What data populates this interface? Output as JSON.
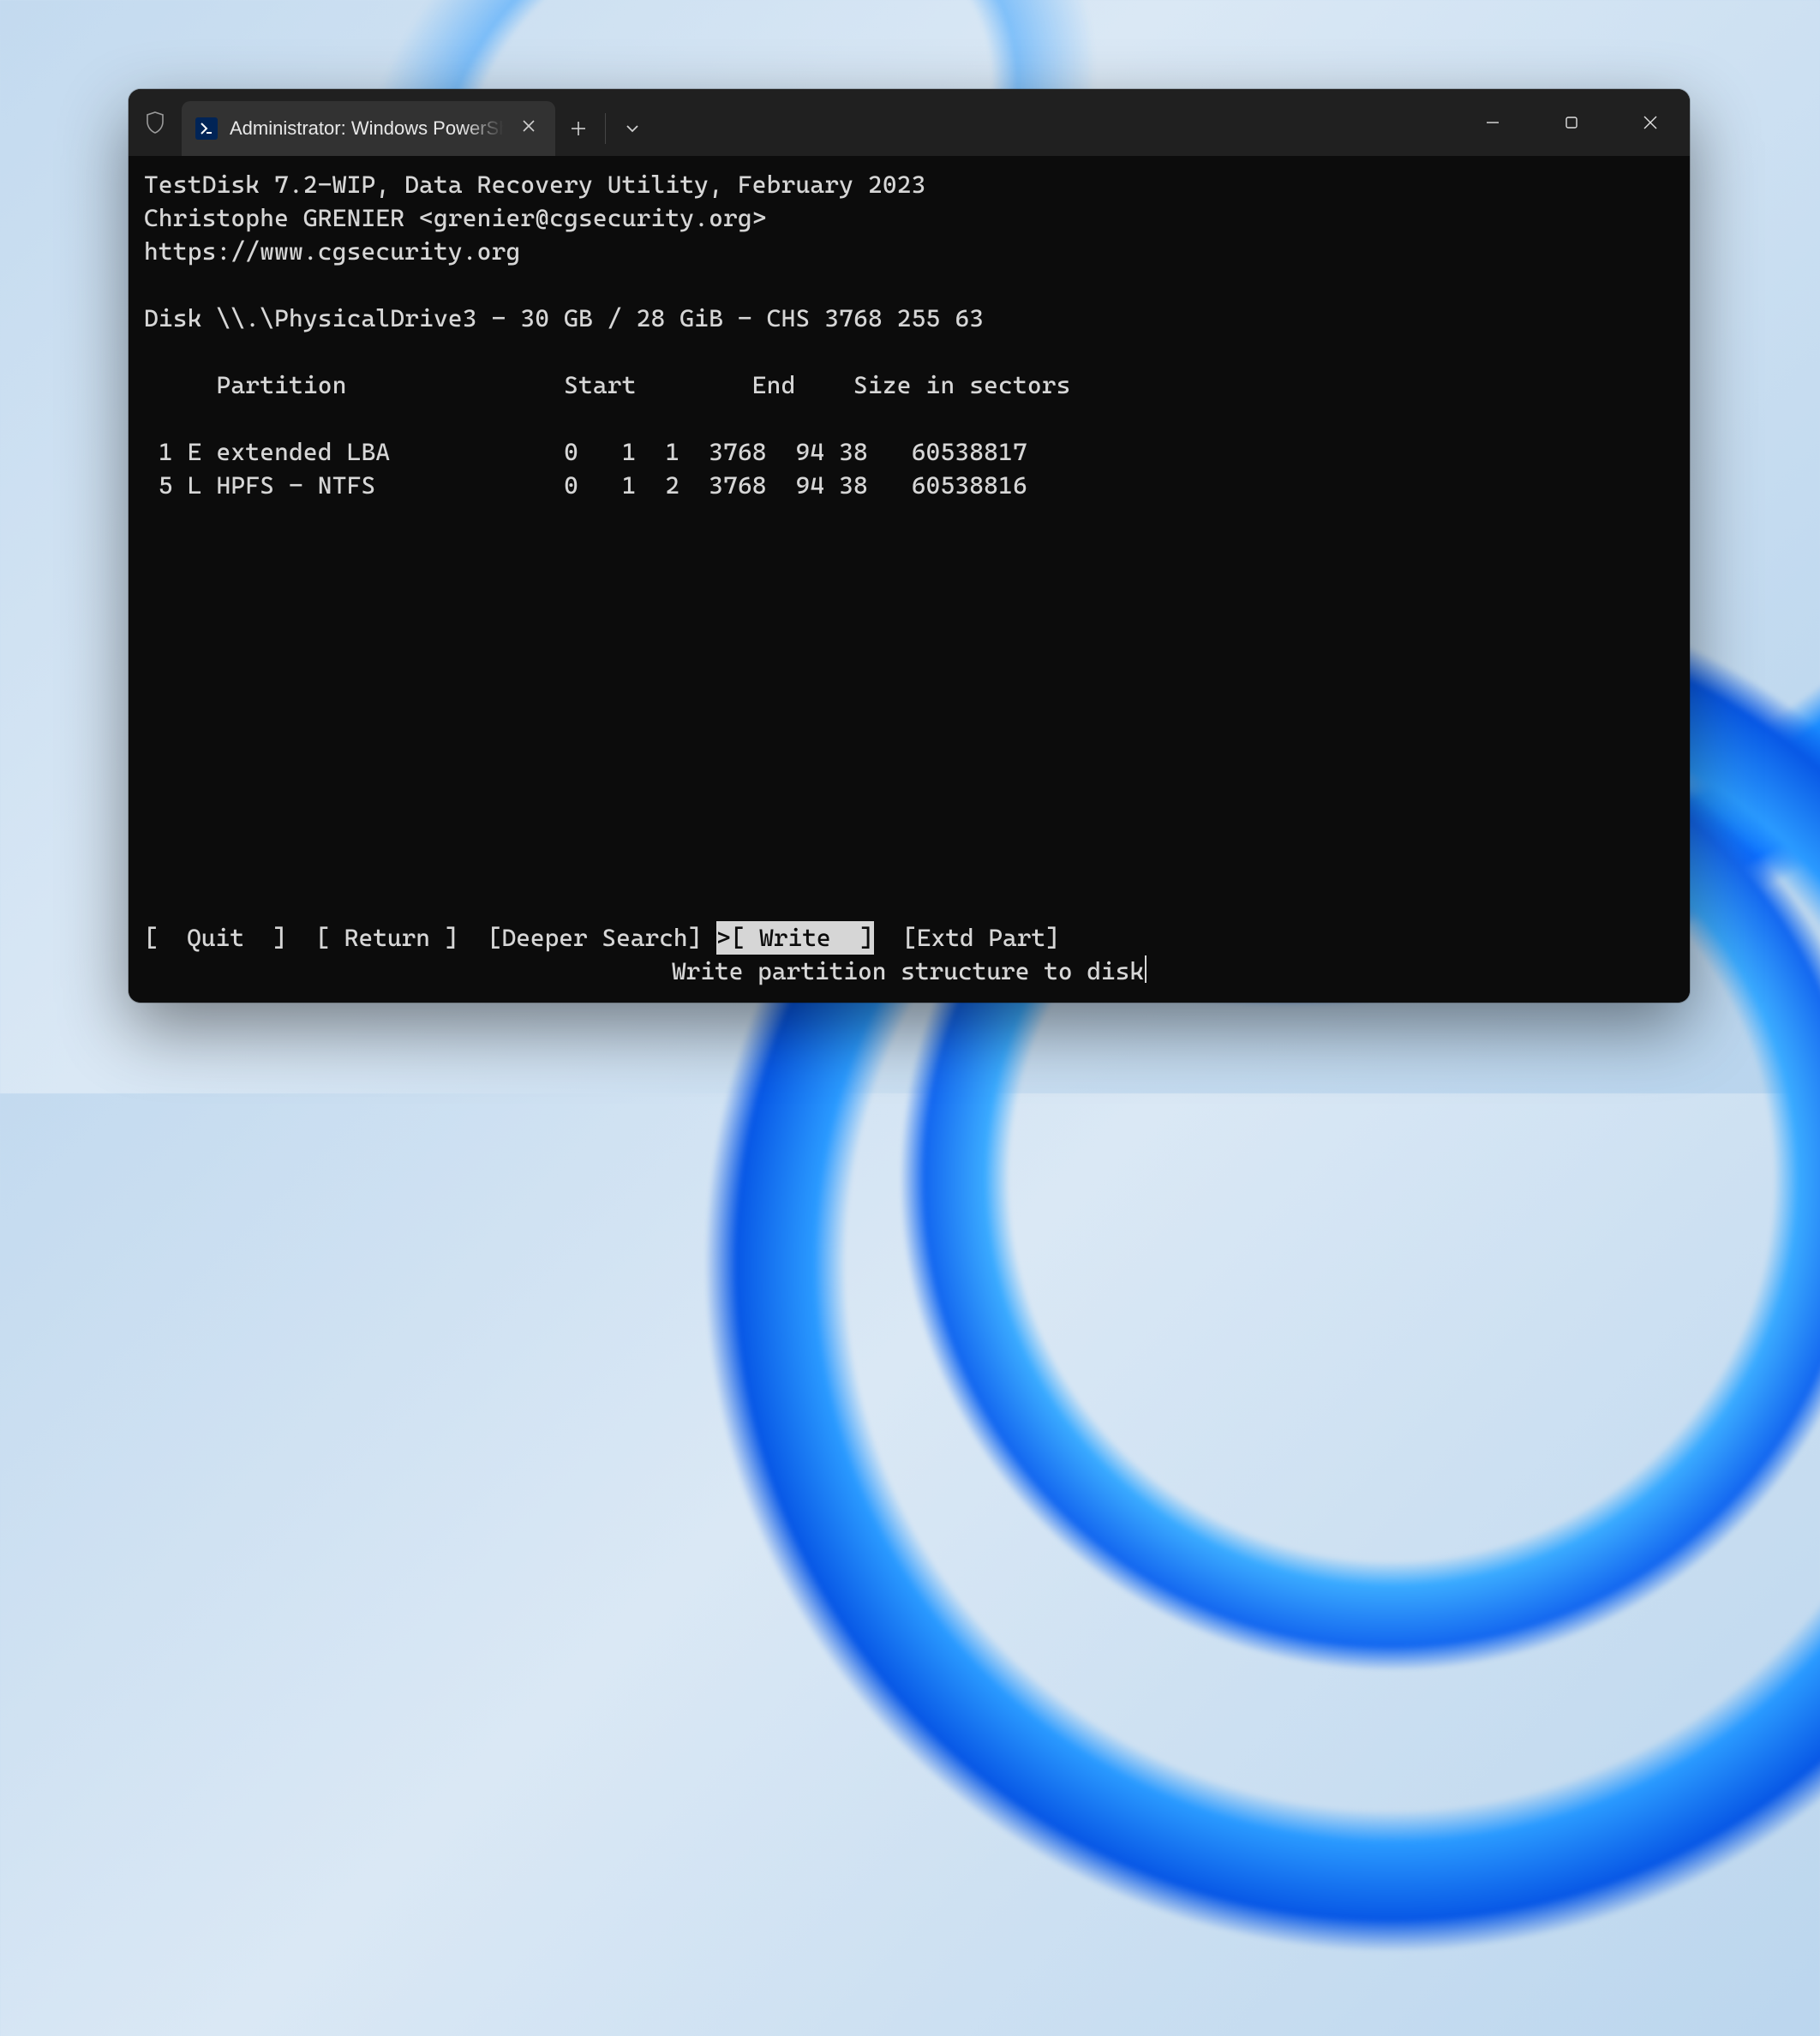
{
  "tab": {
    "title": "Administrator: Windows PowerShell",
    "icon_glyph": ">_"
  },
  "header": {
    "line1": "TestDisk 7.2-WIP, Data Recovery Utility, February 2023",
    "line2": "Christophe GRENIER <grenier@cgsecurity.org>",
    "line3": "https://www.cgsecurity.org"
  },
  "disk_line": "Disk \\\\.\\PhysicalDrive3 - 30 GB / 28 GiB - CHS 3768 255 63",
  "columns_header": "     Partition               Start        End    Size in sectors",
  "partitions": [
    " 1 E extended LBA            0   1  1  3768  94 38   60538817",
    " 5 L HPFS - NTFS             0   1  2  3768  94 38   60538816"
  ],
  "menu": {
    "quit": "[  Quit  ]",
    "return": "[ Return ]",
    "deeper": "[Deeper Search]",
    "write_prefix": ">",
    "write": "[ Write  ]",
    "extd": "[Extd Part]"
  },
  "selected_menu": "write",
  "hint": "Write partition structure to disk"
}
